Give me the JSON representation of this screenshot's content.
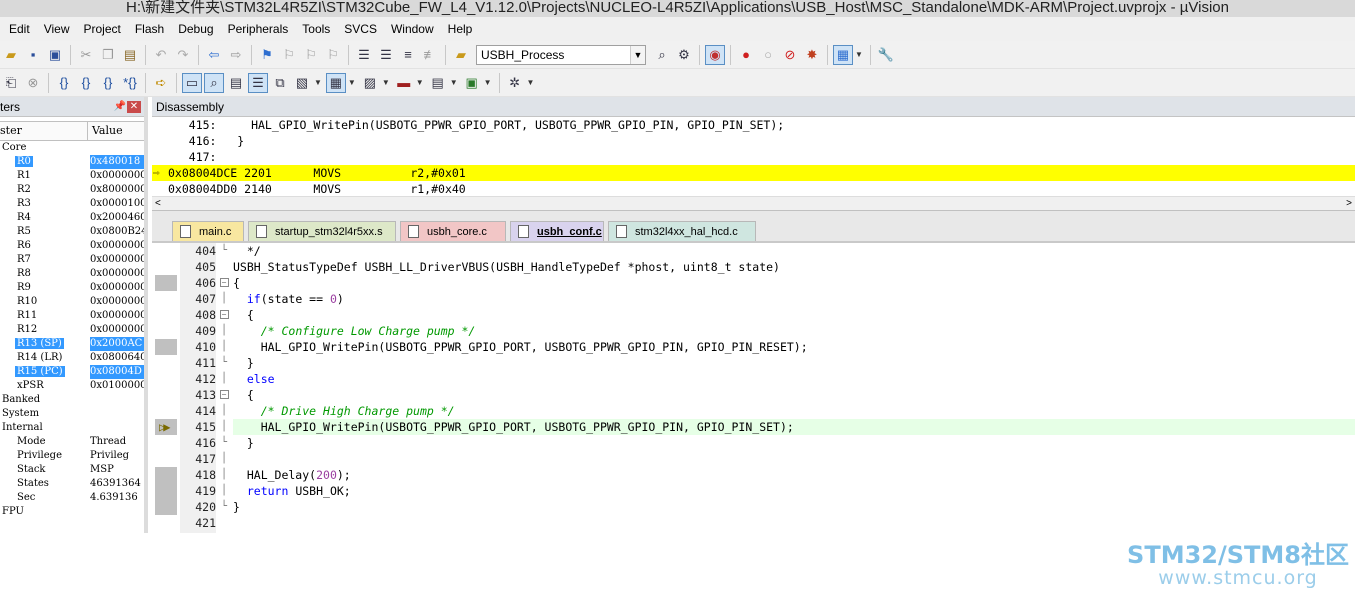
{
  "window": {
    "title": "H:\\新建文件夹\\STM32L4R5ZI\\STM32Cube_FW_L4_V1.12.0\\Projects\\NUCLEO-L4R5ZI\\Applications\\USB_Host\\MSC_Standalone\\MDK-ARM\\Project.uvprojx - µVision"
  },
  "menu": [
    "Edit",
    "View",
    "Project",
    "Flash",
    "Debug",
    "Peripherals",
    "Tools",
    "SVCS",
    "Window",
    "Help"
  ],
  "toolbar": {
    "function_combo": "USBH_Process",
    "icons_row1": [
      "open-icon",
      "save-icon",
      "save-all-icon",
      "cut-icon",
      "copy-icon",
      "paste-icon",
      "undo-icon",
      "redo-icon",
      "nav-back-icon",
      "nav-forward-icon",
      "bookmark-icon",
      "prev-bookmark-icon",
      "next-bookmark-icon",
      "clear-bookmarks-icon",
      "indent-icon",
      "unindent-icon",
      "comment-icon",
      "uncomment-icon",
      "find-in-files-icon"
    ],
    "icons_row2": [
      "reset-icon",
      "stop-icon",
      "step-into-icon",
      "step-over-icon",
      "step-out-icon",
      "run-to-cursor-icon",
      "show-next-statement-icon",
      "command-window-icon",
      "disassembly-window-icon",
      "symbols-window-icon",
      "registers-window-icon",
      "call-stack-icon",
      "watch-window-icon",
      "memory-window-icon",
      "serial-window-icon",
      "analysis-window-icon",
      "trace-window-icon",
      "system-viewer-icon",
      "toolbox-icon"
    ]
  },
  "registers": {
    "title": "ters",
    "col_name": "ster",
    "col_value": "Value",
    "rows": [
      {
        "name": "Core",
        "value": "",
        "indent": 0,
        "sel": false
      },
      {
        "name": "R0",
        "value": "0x480018",
        "indent": 1,
        "sel": true
      },
      {
        "name": "R1",
        "value": "0x0000000",
        "indent": 1,
        "sel": false
      },
      {
        "name": "R2",
        "value": "0x8000000",
        "indent": 1,
        "sel": false
      },
      {
        "name": "R3",
        "value": "0x0000100",
        "indent": 1,
        "sel": false
      },
      {
        "name": "R4",
        "value": "0x2000460",
        "indent": 1,
        "sel": false
      },
      {
        "name": "R5",
        "value": "0x0800B24",
        "indent": 1,
        "sel": false
      },
      {
        "name": "R6",
        "value": "0x0000000",
        "indent": 1,
        "sel": false
      },
      {
        "name": "R7",
        "value": "0x0000000",
        "indent": 1,
        "sel": false
      },
      {
        "name": "R8",
        "value": "0x0000000",
        "indent": 1,
        "sel": false
      },
      {
        "name": "R9",
        "value": "0x0000000",
        "indent": 1,
        "sel": false
      },
      {
        "name": "R10",
        "value": "0x0000000",
        "indent": 1,
        "sel": false
      },
      {
        "name": "R11",
        "value": "0x0000000",
        "indent": 1,
        "sel": false
      },
      {
        "name": "R12",
        "value": "0x0000000",
        "indent": 1,
        "sel": false
      },
      {
        "name": "R13 (SP)",
        "value": "0x2000AC",
        "indent": 1,
        "sel": true
      },
      {
        "name": "R14 (LR)",
        "value": "0x0800640",
        "indent": 1,
        "sel": false
      },
      {
        "name": "R15 (PC)",
        "value": "0x08004D",
        "indent": 1,
        "sel": true
      },
      {
        "name": "xPSR",
        "value": "0x0100000",
        "indent": 1,
        "sel": false
      },
      {
        "name": "Banked",
        "value": "",
        "indent": 0,
        "sel": false
      },
      {
        "name": "System",
        "value": "",
        "indent": 0,
        "sel": false
      },
      {
        "name": "Internal",
        "value": "",
        "indent": 0,
        "sel": false
      },
      {
        "name": "Mode",
        "value": "Thread",
        "indent": 1,
        "sel": false
      },
      {
        "name": "Privilege",
        "value": "Privileg",
        "indent": 1,
        "sel": false
      },
      {
        "name": "Stack",
        "value": "MSP",
        "indent": 1,
        "sel": false
      },
      {
        "name": "States",
        "value": "46391364",
        "indent": 1,
        "sel": false
      },
      {
        "name": "Sec",
        "value": "4.639136",
        "indent": 1,
        "sel": false
      },
      {
        "name": "FPU",
        "value": "",
        "indent": 0,
        "sel": false
      }
    ]
  },
  "disassembly": {
    "title": "Disassembly",
    "lines": [
      {
        "text": "   415:     HAL_GPIO_WritePin(USBOTG_PPWR_GPIO_PORT, USBOTG_PPWR_GPIO_PIN, GPIO_PIN_SET);",
        "current": false
      },
      {
        "text": "   416:   }",
        "current": false
      },
      {
        "text": "   417:",
        "current": false
      },
      {
        "text": "0x08004DCE 2201      MOVS          r2,#0x01",
        "current": true
      },
      {
        "text": "0x08004DD0 2140      MOVS          r1,#0x40",
        "current": false
      }
    ],
    "scroll_left": "<",
    "scroll_right": ">"
  },
  "tabs": [
    {
      "label": "main.c",
      "color": "#f8e7a0",
      "active": false
    },
    {
      "label": "startup_stm32l4r5xx.s",
      "color": "#dde8c8",
      "active": false
    },
    {
      "label": "usbh_core.c",
      "color": "#f2c6c6",
      "active": false
    },
    {
      "label": "usbh_conf.c",
      "color": "#d9d3ee",
      "active": true
    },
    {
      "label": "stm32l4xx_hal_hcd.c",
      "color": "#cfe6e0",
      "active": false
    }
  ],
  "editor": {
    "lines": [
      {
        "num": "404",
        "fold": "end",
        "mark": false,
        "hl": false,
        "arrow": false,
        "html": "  */"
      },
      {
        "num": "405",
        "fold": "",
        "mark": false,
        "hl": false,
        "arrow": false,
        "html": "USBH_StatusTypeDef USBH_LL_DriverVBUS(USBH_HandleTypeDef *phost, uint8_t state)"
      },
      {
        "num": "406",
        "fold": "box",
        "mark": true,
        "hl": false,
        "arrow": false,
        "html": "{"
      },
      {
        "num": "407",
        "fold": "line",
        "mark": false,
        "hl": false,
        "arrow": false,
        "html": "  if(state == 0)"
      },
      {
        "num": "408",
        "fold": "box",
        "mark": false,
        "hl": false,
        "arrow": false,
        "html": "  {"
      },
      {
        "num": "409",
        "fold": "line",
        "mark": false,
        "hl": false,
        "arrow": false,
        "html": "    /* Configure Low Charge pump */"
      },
      {
        "num": "410",
        "fold": "line",
        "mark": true,
        "hl": false,
        "arrow": false,
        "html": "    HAL_GPIO_WritePin(USBOTG_PPWR_GPIO_PORT, USBOTG_PPWR_GPIO_PIN, GPIO_PIN_RESET);"
      },
      {
        "num": "411",
        "fold": "end",
        "mark": false,
        "hl": false,
        "arrow": false,
        "html": "  }"
      },
      {
        "num": "412",
        "fold": "line",
        "mark": false,
        "hl": false,
        "arrow": false,
        "html": "  else"
      },
      {
        "num": "413",
        "fold": "box",
        "mark": false,
        "hl": false,
        "arrow": false,
        "html": "  {"
      },
      {
        "num": "414",
        "fold": "line",
        "mark": false,
        "hl": false,
        "arrow": false,
        "html": "    /* Drive High Charge pump */"
      },
      {
        "num": "415",
        "fold": "line",
        "mark": true,
        "hl": true,
        "arrow": true,
        "html": "    HAL_GPIO_WritePin(USBOTG_PPWR_GPIO_PORT, USBOTG_PPWR_GPIO_PIN, GPIO_PIN_SET);"
      },
      {
        "num": "416",
        "fold": "end",
        "mark": false,
        "hl": false,
        "arrow": false,
        "html": "  }"
      },
      {
        "num": "417",
        "fold": "line",
        "mark": false,
        "hl": false,
        "arrow": false,
        "html": ""
      },
      {
        "num": "418",
        "fold": "line",
        "mark": true,
        "hl": false,
        "arrow": false,
        "html": "  HAL_Delay(200);"
      },
      {
        "num": "419",
        "fold": "line",
        "mark": true,
        "hl": false,
        "arrow": false,
        "html": "  return USBH_OK;"
      },
      {
        "num": "420",
        "fold": "end",
        "mark": true,
        "hl": false,
        "arrow": false,
        "html": "}"
      },
      {
        "num": "421",
        "fold": "",
        "mark": false,
        "hl": false,
        "arrow": false,
        "html": ""
      }
    ]
  },
  "watermark": {
    "line1": "STM32/STM8社区",
    "line2": "www.stmcu.org"
  }
}
